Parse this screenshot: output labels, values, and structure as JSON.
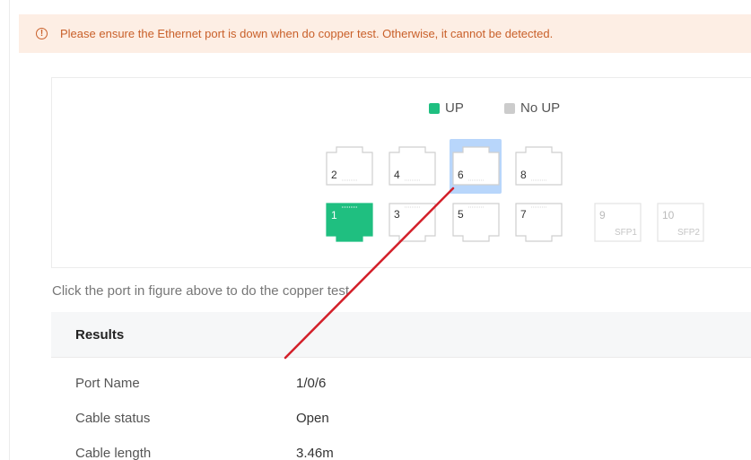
{
  "alert": {
    "icon": "info-circle-icon",
    "text": "Please ensure the Ethernet port is down when do copper test. Otherwise, it cannot be detected."
  },
  "legend": {
    "up_label": "UP",
    "up_color": "#1fbf80",
    "noup_label": "No UP",
    "noup_color": "#cccccc"
  },
  "ports": {
    "top": [
      "2",
      "4",
      "6",
      "8"
    ],
    "bottom": [
      "1",
      "3",
      "5",
      "7"
    ],
    "sfp": [
      {
        "num": "9",
        "label": "SFP1"
      },
      {
        "num": "10",
        "label": "SFP2"
      }
    ],
    "up_port": "1",
    "selected_port": "6"
  },
  "hint": "Click the port in figure above to do the copper test",
  "results": {
    "title": "Results",
    "rows": [
      {
        "label": "Port Name",
        "value": "1/0/6"
      },
      {
        "label": "Cable status",
        "value": "Open"
      },
      {
        "label": "Cable length",
        "value": "3.46m"
      }
    ]
  },
  "annotation_color": "#d3202a"
}
